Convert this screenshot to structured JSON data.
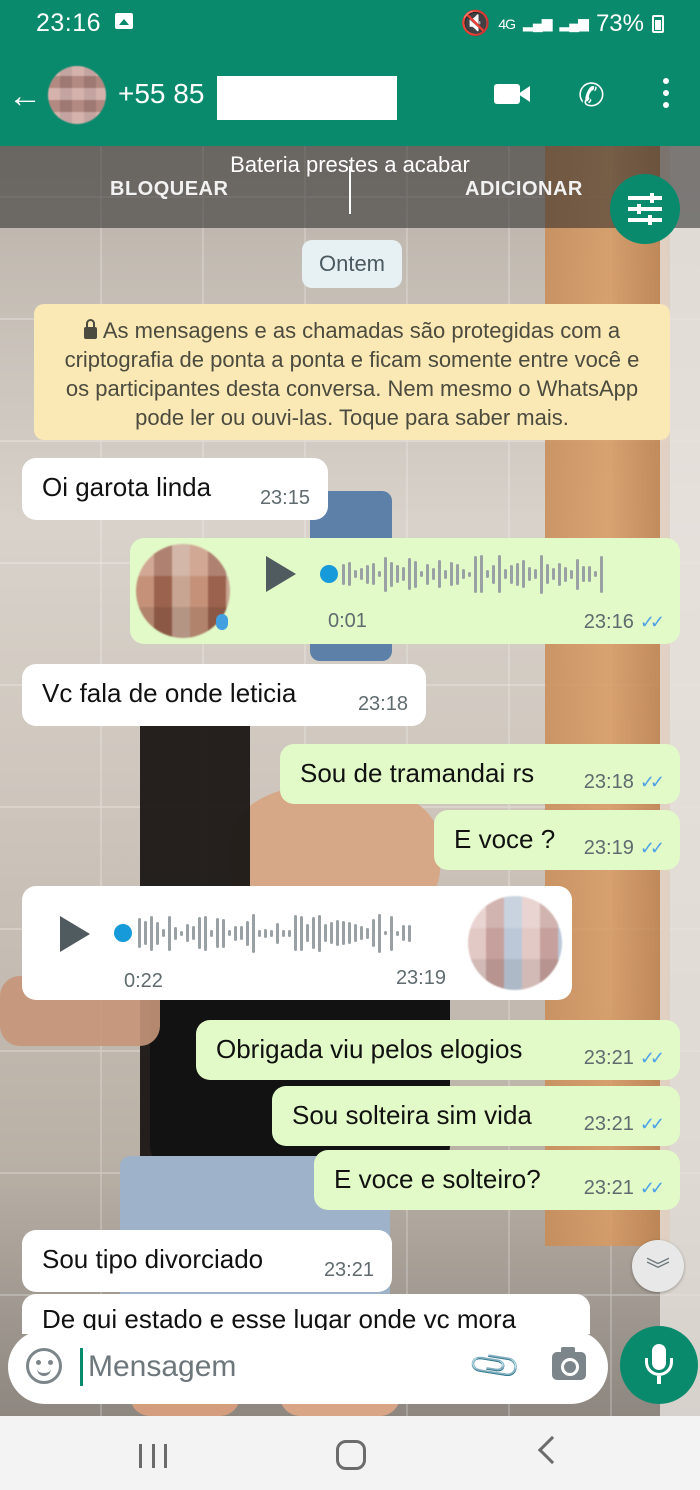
{
  "status_bar": {
    "time": "23:16",
    "network": "4G",
    "battery": "73%"
  },
  "header": {
    "contact": "+55 85",
    "icons": [
      "back-arrow-icon",
      "video-call-icon",
      "phone-icon",
      "more-options-icon"
    ]
  },
  "banner": {
    "title": "Bateria prestes a acabar",
    "block_label": "BLOQUEAR",
    "add_label": "ADICIONAR"
  },
  "date_chip": "Ontem",
  "encryption_notice": "As mensagens e as chamadas são protegidas com a criptografia de ponta a ponta e ficam somente entre você e os participantes desta conversa. Nem mesmo o WhatsApp pode ler ou ouvi-las. Toque para saber mais.",
  "messages": [
    {
      "dir": "in",
      "type": "text",
      "text": "Oi garota linda",
      "time": "23:15"
    },
    {
      "dir": "out",
      "type": "voice",
      "duration": "0:01",
      "time": "23:16"
    },
    {
      "dir": "in",
      "type": "text",
      "text": "Vc fala de onde leticia",
      "time": "23:18"
    },
    {
      "dir": "out",
      "type": "text",
      "text": "Sou de tramandai rs",
      "time": "23:18"
    },
    {
      "dir": "out",
      "type": "text",
      "text": "E voce ?",
      "time": "23:19"
    },
    {
      "dir": "in",
      "type": "voice",
      "duration": "0:22",
      "time": "23:19"
    },
    {
      "dir": "out",
      "type": "text",
      "text": "Obrigada viu pelos elogios",
      "time": "23:21"
    },
    {
      "dir": "out",
      "type": "text",
      "text": "Sou solteira sim vida",
      "time": "23:21"
    },
    {
      "dir": "out",
      "type": "text",
      "text": "E voce e solteiro?",
      "time": "23:21"
    },
    {
      "dir": "in",
      "type": "text",
      "text": "Sou tipo divorciado",
      "time": "23:21"
    }
  ],
  "partial_message": "De qui estado e esse lugar onde vc mora",
  "composer": {
    "placeholder": "Mensagem"
  },
  "colors": {
    "primary": "#0a8a6d",
    "outgoing_bubble": "#e2fac8",
    "incoming_bubble": "#ffffff",
    "read_ticks": "#4ea2e8",
    "system_notice": "#fbe9b5"
  }
}
